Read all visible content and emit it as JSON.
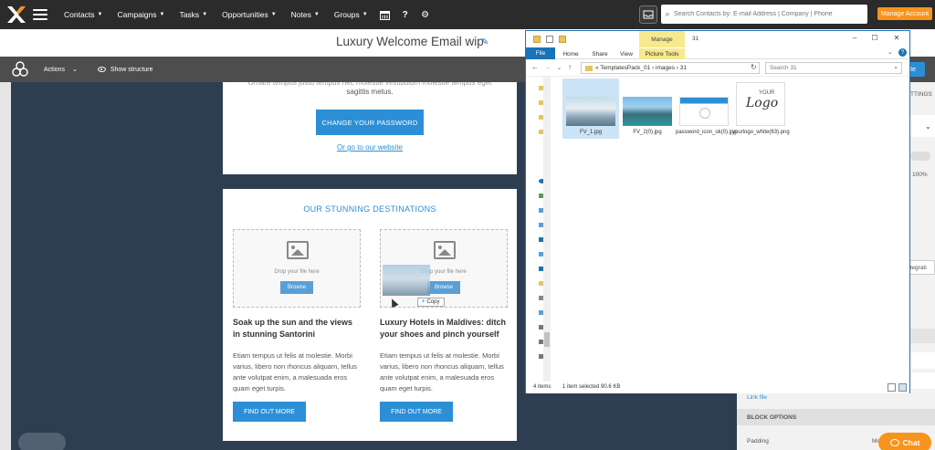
{
  "nav": {
    "menus": [
      {
        "label": "Contacts"
      },
      {
        "label": "Campaigns"
      },
      {
        "label": "Tasks"
      },
      {
        "label": "Opportunities"
      },
      {
        "label": "Notes"
      },
      {
        "label": "Groups"
      }
    ],
    "search_placeholder": "Search Contacts by: E-mail Address | Company | Phone",
    "manage_account": "Manage Account",
    "icons": [
      "calendar-icon",
      "help-icon",
      "gear-icon",
      "inbox-icon",
      "search-icon",
      "hamburger-icon"
    ],
    "brand_color": "#f7941d"
  },
  "editor": {
    "title": "Luxury Welcome Email wip",
    "toolbar": {
      "actions": "Actions",
      "show_structure": "Show structure"
    },
    "card1": {
      "text_line1": "Ornare tempus justo tempus nec molestie vestibulum molestie tempus eget",
      "text_line2": "sagittis metus.",
      "button": "CHANGE YOUR PASSWORD",
      "link": "Or go to our website"
    },
    "card2": {
      "heading": "OUR STUNNING DESTINATIONS",
      "drop_text": "Drop your file here",
      "browse": "Browse",
      "copy_tip": "Copy",
      "left": {
        "title": "Soak up the sun and the views in stunning Santorini",
        "body": "Etiam tempus ut felis at molestie. Morbi varius, libero non rhoncus aliquam, tellus ante volutpat enim, a malesuada eros quam eget turpis.",
        "button": "FIND OUT MORE"
      },
      "right": {
        "title": "Luxury Hotels in Maldives: ditch your shoes and pinch yourself",
        "body": "Etiam tempus ut felis at molestie. Morbi varius, libero non rhoncus aliquam, tellus ante volutpat enim, a malesuada eros quam eget turpis.",
        "button": "FIND OUT MORE"
      }
    },
    "accent_color": "#2c8fd6"
  },
  "right_panel": {
    "ttings": "TTINGS",
    "percent": "100%",
    "integrate": "ntegrati",
    "link_file": "Link file",
    "block_options": "BLOCK OPTIONS",
    "padding": "Padding",
    "padding_value": "Mo",
    "save_partial": "ate"
  },
  "explorer": {
    "manage_tab": "Manage",
    "title_path": "31",
    "tabs": [
      "File",
      "Home",
      "Share",
      "View",
      "Picture Tools"
    ],
    "breadcrumb": "«  TemplatesPack_01  ›  images  ›  31",
    "search_placeholder": "Search 31",
    "files": [
      {
        "name": "FV_1.jpg",
        "selected": true
      },
      {
        "name": "FV_2(0).jpg",
        "selected": false
      },
      {
        "name": "password_icon_ok(0).jpg",
        "selected": false
      },
      {
        "name": "yourlogo_white(63).png",
        "selected": false
      }
    ],
    "logo_text_top": "YOUR",
    "logo_text_main": "Logo",
    "status_items": "4 items",
    "status_selected": "1 item selected  90.6 KB"
  },
  "chat": {
    "label": "Chat"
  }
}
